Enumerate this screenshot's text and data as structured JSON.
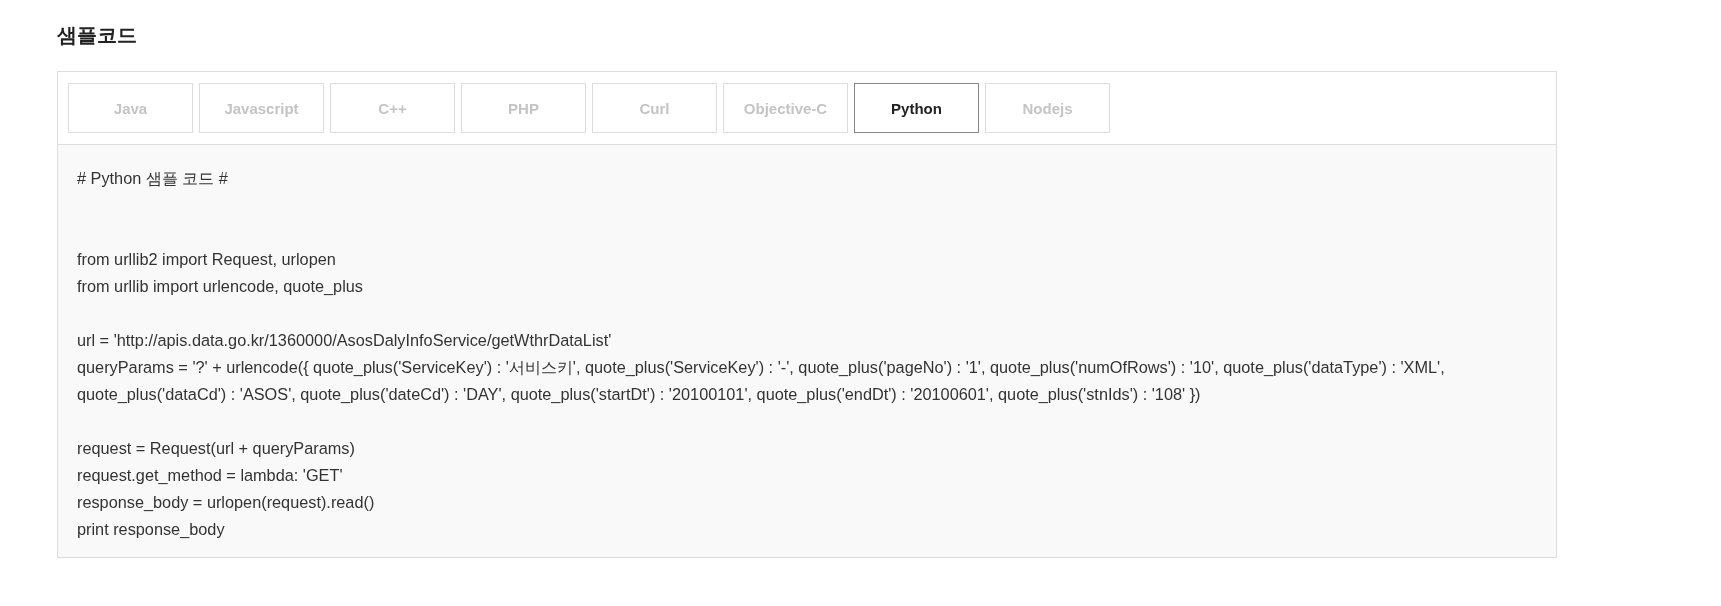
{
  "heading": "샘플코드",
  "tabs": [
    {
      "label": "Java",
      "selected": false
    },
    {
      "label": "Javascript",
      "selected": false
    },
    {
      "label": "C++",
      "selected": false
    },
    {
      "label": "PHP",
      "selected": false
    },
    {
      "label": "Curl",
      "selected": false
    },
    {
      "label": "Objective-C",
      "selected": false
    },
    {
      "label": "Python",
      "selected": true
    },
    {
      "label": "Nodejs",
      "selected": false
    }
  ],
  "code_blocks": [
    [
      "# Python 샘플 코드 #"
    ],
    [
      "from urllib2 import Request, urlopen",
      "from urllib import urlencode, quote_plus"
    ],
    [
      "url = 'http://apis.data.go.kr/1360000/AsosDalyInfoService/getWthrDataList'",
      "queryParams = '?' + urlencode({ quote_plus('ServiceKey') : '서비스키', quote_plus('ServiceKey') : '-', quote_plus('pageNo') : '1', quote_plus('numOfRows') : '10', quote_plus('dataType') : 'XML', quote_plus('dataCd') : 'ASOS', quote_plus('dateCd') : 'DAY', quote_plus('startDt') : '20100101', quote_plus('endDt') : '20100601', quote_plus('stnIds') : '108' })"
    ],
    [
      "request = Request(url + queryParams)",
      "request.get_method = lambda: 'GET'",
      "response_body = urlopen(request).read()",
      "print response_body"
    ]
  ]
}
